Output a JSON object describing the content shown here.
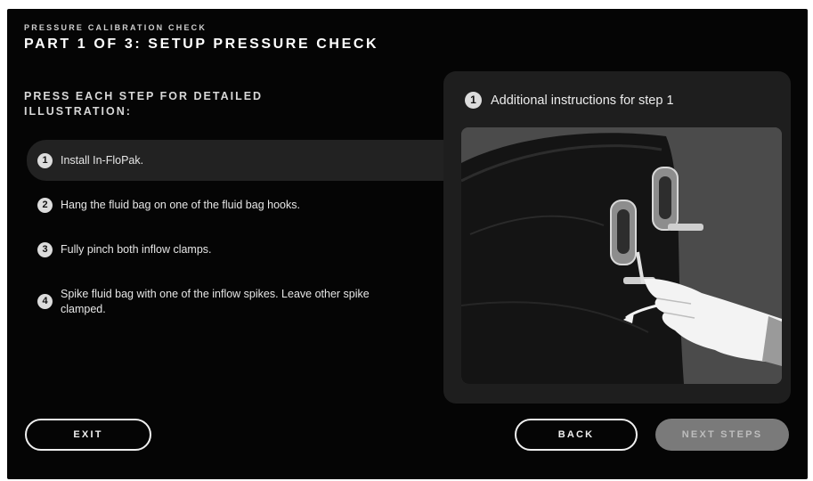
{
  "header": {
    "subtitle": "PRESSURE CALIBRATION CHECK",
    "title": "PART 1 OF 3: SETUP PRESSURE CHECK"
  },
  "prompt": "PRESS EACH STEP FOR DETAILED ILLUSTRATION:",
  "steps": [
    {
      "number": "1",
      "text": "Install In-FloPak.",
      "active": true
    },
    {
      "number": "2",
      "text": "Hang the fluid bag on one of the fluid bag hooks.",
      "active": false
    },
    {
      "number": "3",
      "text": "Fully pinch both inflow clamps.",
      "active": false
    },
    {
      "number": "4",
      "text": "Spike fluid bag with one of the inflow spikes. Leave other spike clamped.",
      "active": false
    }
  ],
  "panel": {
    "number": "1",
    "title": "Additional instructions for step 1"
  },
  "buttons": {
    "exit": "EXIT",
    "back": "BACK",
    "next": "NEXT STEPS"
  }
}
